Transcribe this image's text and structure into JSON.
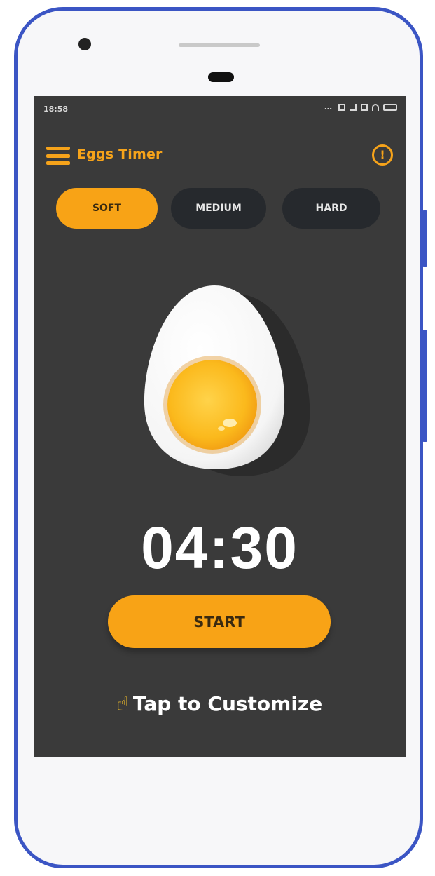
{
  "status_bar": {
    "time": "18:58",
    "icons": [
      "signal-dots-icon",
      "sim-icon",
      "signal-icon",
      "data-icon",
      "wifi-icon",
      "battery-icon"
    ]
  },
  "app_bar": {
    "title": "Eggs Timer",
    "menu_icon": "hamburger-menu-icon",
    "info_icon": "info-icon",
    "info_glyph": "!"
  },
  "modes": [
    {
      "label": "SOFT",
      "selected": true
    },
    {
      "label": "MEDIUM",
      "selected": false
    },
    {
      "label": "HARD",
      "selected": false
    }
  ],
  "timer": {
    "value": "04:30"
  },
  "start_button": {
    "label": "START"
  },
  "customize": {
    "icon": "tap-hand-icon",
    "label": "Tap to Customize"
  },
  "colors": {
    "accent": "#f8a316",
    "screen_bg": "#3a3a3a",
    "segment_inactive": "#26292d",
    "phone_frame": "#3b55c4"
  }
}
